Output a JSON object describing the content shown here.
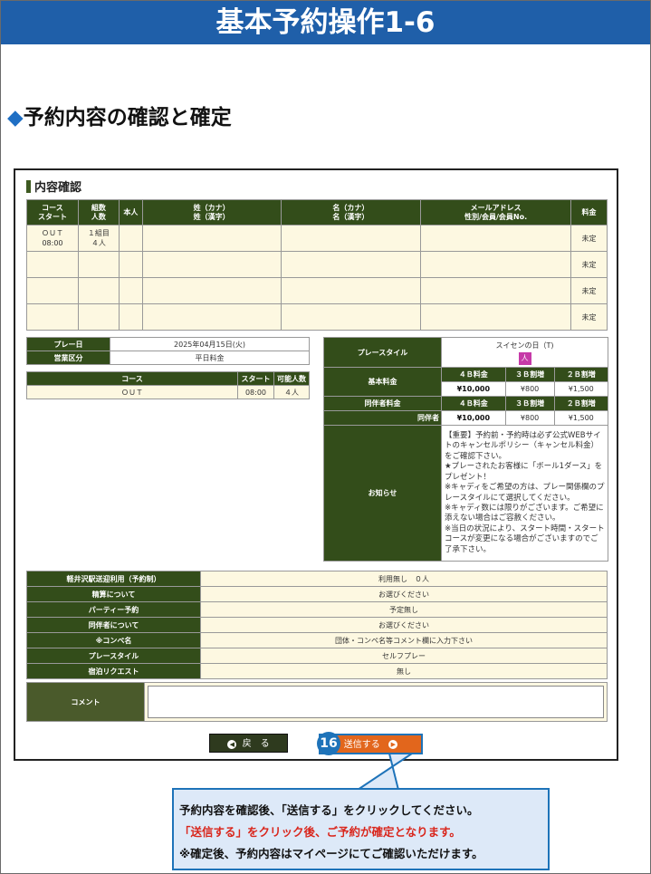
{
  "banner": {
    "title": "基本予約操作1-6"
  },
  "section": {
    "title": "予約内容の確認と確定",
    "marker": "◆"
  },
  "panel": {
    "title": "内容確認",
    "main_headers": [
      "コース\nスタート",
      "組数\n人数",
      "本人",
      "姓（カナ）\n姓（漢字）",
      "名（カナ）\n名（漢字）",
      "メールアドレス\n性別/会員/会員No.",
      "料金"
    ],
    "rows": [
      {
        "course": "ＯＵＴ\n08:00",
        "group": "１組目\n４人",
        "fee": "未定"
      },
      {
        "course": "",
        "group": "",
        "fee": "未定"
      },
      {
        "course": "",
        "group": "",
        "fee": "未定"
      },
      {
        "course": "",
        "group": "",
        "fee": "未定"
      }
    ],
    "play_date_label": "プレー日",
    "play_date": "2025年04月15日(火)",
    "business_label": "営業区分",
    "business_value": "平日料金",
    "course_headers": [
      "コース",
      "スタート",
      "可能人数"
    ],
    "course_row": [
      "ＯＵＴ",
      "08:00",
      "４人"
    ],
    "play_style_label": "プレースタイル",
    "play_style_value": "スイセンの日（T)",
    "badge_text": "セルフ",
    "base_fee_label": "基本料金",
    "fee_headers": [
      "４Ｂ料金",
      "３Ｂ割増",
      "２Ｂ割増"
    ],
    "base_fees": [
      "¥10,000",
      "¥800",
      "¥1,500"
    ],
    "comp_fee_label": "同伴者料金",
    "comp_sub_label": "同伴者",
    "comp_fees": [
      "¥10,000",
      "¥800",
      "¥1,500"
    ],
    "notice_label": "お知らせ",
    "notice_text": "【重要】予約前・予約時は必ず公式WEBサイトのキャンセルポリシー（キャンセル料金）をご確認下さい。\n★プレーされたお客様に「ボール1ダース」をプレゼント！\n※キャディをご希望の方は、プレー関係欄のプレースタイルにて選択してください。\n※キャディ数には限りがございます。ご希望に添えない場合はご容赦ください。\n※当日の状況により、スタート時間・スタートコースが変更になる場合がございますのでご了承下さい。",
    "options": [
      {
        "label": "軽井沢駅送迎利用（予約制）",
        "value": "利用無し　０人"
      },
      {
        "label": "精算について",
        "value": "お選びください"
      },
      {
        "label": "パーティー予約",
        "value": "予定無し"
      },
      {
        "label": "同伴者について",
        "value": "お選びください"
      },
      {
        "label": "※コンペ名",
        "value": "団体・コンペ名等コメント欄に入力下さい"
      },
      {
        "label": "プレースタイル",
        "value": "セルフプレー"
      },
      {
        "label": "宿泊リクエスト",
        "value": "無し"
      }
    ],
    "comment_label": "コメント",
    "comment_value": "",
    "back_label": "戻　る",
    "send_label": "送信する"
  },
  "step_number": "16",
  "callout": {
    "line1": "予約内容を確認後、「送信する」をクリックしてください。",
    "line2": "「送信する」をクリック後、ご予約が確定となります。",
    "line3": "※確定後、予約内容はマイページにてご確認いただけます。"
  },
  "colors": {
    "banner": "#1f5fa9",
    "header_green": "#334d1a",
    "cell_cream": "#fdf8e1",
    "send_orange": "#e2661c",
    "accent_blue": "#1e73b9",
    "alert_red": "#d9261c"
  }
}
